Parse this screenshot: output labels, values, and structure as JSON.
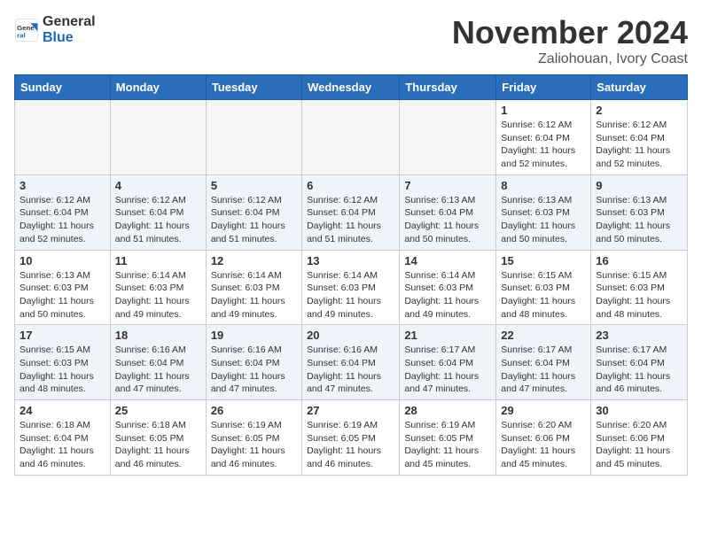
{
  "logo": {
    "general": "General",
    "blue": "Blue"
  },
  "title": "November 2024",
  "location": "Zaliohouan, Ivory Coast",
  "days_of_week": [
    "Sunday",
    "Monday",
    "Tuesday",
    "Wednesday",
    "Thursday",
    "Friday",
    "Saturday"
  ],
  "weeks": [
    [
      {
        "day": "",
        "info": ""
      },
      {
        "day": "",
        "info": ""
      },
      {
        "day": "",
        "info": ""
      },
      {
        "day": "",
        "info": ""
      },
      {
        "day": "",
        "info": ""
      },
      {
        "day": "1",
        "info": "Sunrise: 6:12 AM\nSunset: 6:04 PM\nDaylight: 11 hours\nand 52 minutes."
      },
      {
        "day": "2",
        "info": "Sunrise: 6:12 AM\nSunset: 6:04 PM\nDaylight: 11 hours\nand 52 minutes."
      }
    ],
    [
      {
        "day": "3",
        "info": "Sunrise: 6:12 AM\nSunset: 6:04 PM\nDaylight: 11 hours\nand 52 minutes."
      },
      {
        "day": "4",
        "info": "Sunrise: 6:12 AM\nSunset: 6:04 PM\nDaylight: 11 hours\nand 51 minutes."
      },
      {
        "day": "5",
        "info": "Sunrise: 6:12 AM\nSunset: 6:04 PM\nDaylight: 11 hours\nand 51 minutes."
      },
      {
        "day": "6",
        "info": "Sunrise: 6:12 AM\nSunset: 6:04 PM\nDaylight: 11 hours\nand 51 minutes."
      },
      {
        "day": "7",
        "info": "Sunrise: 6:13 AM\nSunset: 6:04 PM\nDaylight: 11 hours\nand 50 minutes."
      },
      {
        "day": "8",
        "info": "Sunrise: 6:13 AM\nSunset: 6:03 PM\nDaylight: 11 hours\nand 50 minutes."
      },
      {
        "day": "9",
        "info": "Sunrise: 6:13 AM\nSunset: 6:03 PM\nDaylight: 11 hours\nand 50 minutes."
      }
    ],
    [
      {
        "day": "10",
        "info": "Sunrise: 6:13 AM\nSunset: 6:03 PM\nDaylight: 11 hours\nand 50 minutes."
      },
      {
        "day": "11",
        "info": "Sunrise: 6:14 AM\nSunset: 6:03 PM\nDaylight: 11 hours\nand 49 minutes."
      },
      {
        "day": "12",
        "info": "Sunrise: 6:14 AM\nSunset: 6:03 PM\nDaylight: 11 hours\nand 49 minutes."
      },
      {
        "day": "13",
        "info": "Sunrise: 6:14 AM\nSunset: 6:03 PM\nDaylight: 11 hours\nand 49 minutes."
      },
      {
        "day": "14",
        "info": "Sunrise: 6:14 AM\nSunset: 6:03 PM\nDaylight: 11 hours\nand 49 minutes."
      },
      {
        "day": "15",
        "info": "Sunrise: 6:15 AM\nSunset: 6:03 PM\nDaylight: 11 hours\nand 48 minutes."
      },
      {
        "day": "16",
        "info": "Sunrise: 6:15 AM\nSunset: 6:03 PM\nDaylight: 11 hours\nand 48 minutes."
      }
    ],
    [
      {
        "day": "17",
        "info": "Sunrise: 6:15 AM\nSunset: 6:03 PM\nDaylight: 11 hours\nand 48 minutes."
      },
      {
        "day": "18",
        "info": "Sunrise: 6:16 AM\nSunset: 6:04 PM\nDaylight: 11 hours\nand 47 minutes."
      },
      {
        "day": "19",
        "info": "Sunrise: 6:16 AM\nSunset: 6:04 PM\nDaylight: 11 hours\nand 47 minutes."
      },
      {
        "day": "20",
        "info": "Sunrise: 6:16 AM\nSunset: 6:04 PM\nDaylight: 11 hours\nand 47 minutes."
      },
      {
        "day": "21",
        "info": "Sunrise: 6:17 AM\nSunset: 6:04 PM\nDaylight: 11 hours\nand 47 minutes."
      },
      {
        "day": "22",
        "info": "Sunrise: 6:17 AM\nSunset: 6:04 PM\nDaylight: 11 hours\nand 47 minutes."
      },
      {
        "day": "23",
        "info": "Sunrise: 6:17 AM\nSunset: 6:04 PM\nDaylight: 11 hours\nand 46 minutes."
      }
    ],
    [
      {
        "day": "24",
        "info": "Sunrise: 6:18 AM\nSunset: 6:04 PM\nDaylight: 11 hours\nand 46 minutes."
      },
      {
        "day": "25",
        "info": "Sunrise: 6:18 AM\nSunset: 6:05 PM\nDaylight: 11 hours\nand 46 minutes."
      },
      {
        "day": "26",
        "info": "Sunrise: 6:19 AM\nSunset: 6:05 PM\nDaylight: 11 hours\nand 46 minutes."
      },
      {
        "day": "27",
        "info": "Sunrise: 6:19 AM\nSunset: 6:05 PM\nDaylight: 11 hours\nand 46 minutes."
      },
      {
        "day": "28",
        "info": "Sunrise: 6:19 AM\nSunset: 6:05 PM\nDaylight: 11 hours\nand 45 minutes."
      },
      {
        "day": "29",
        "info": "Sunrise: 6:20 AM\nSunset: 6:06 PM\nDaylight: 11 hours\nand 45 minutes."
      },
      {
        "day": "30",
        "info": "Sunrise: 6:20 AM\nSunset: 6:06 PM\nDaylight: 11 hours\nand 45 minutes."
      }
    ]
  ]
}
